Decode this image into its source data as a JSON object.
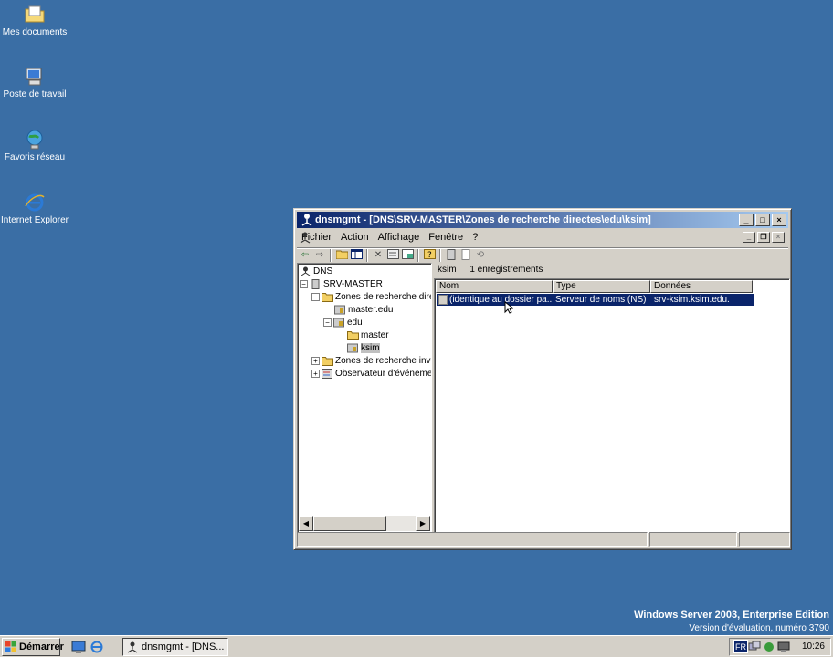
{
  "desktop": {
    "icons": [
      {
        "label": "Mes documents"
      },
      {
        "label": "Poste de travail"
      },
      {
        "label": "Favoris réseau"
      },
      {
        "label": "Internet Explorer"
      }
    ],
    "watermark_line1": "Windows Server 2003, Enterprise Edition",
    "watermark_line2": "Version d'évaluation, numéro 3790",
    "background_color": "#3a6ea5"
  },
  "window": {
    "title": "dnsmgmt - [DNS\\SRV-MASTER\\Zones de recherche directes\\edu\\ksim]",
    "menu": [
      "Fichier",
      "Action",
      "Affichage",
      "Fenêtre",
      "?"
    ],
    "tree": [
      {
        "label": "DNS",
        "icon": "dns-icon"
      },
      {
        "label": "SRV-MASTER",
        "icon": "server-icon"
      },
      {
        "label": "Zones de recherche directes",
        "icon": "folder-icon"
      },
      {
        "label": "master.edu",
        "icon": "zone-icon"
      },
      {
        "label": "edu",
        "icon": "zone-icon"
      },
      {
        "label": "master",
        "icon": "folder-icon"
      },
      {
        "label": "ksim",
        "icon": "zone-icon"
      },
      {
        "label": "Zones de recherche inversée",
        "icon": "folder-icon"
      },
      {
        "label": "Observateur d'événements",
        "icon": "event-viewer-icon"
      }
    ],
    "pane_header": {
      "name": "ksim",
      "count": "1 enregistrements"
    },
    "columns": [
      "Nom",
      "Type",
      "Données"
    ],
    "rows": [
      {
        "name": "(identique au dossier pa...",
        "type": "Serveur de noms (NS)",
        "data": "srv-ksim.ksim.edu."
      }
    ]
  },
  "taskbar": {
    "start_label": "Démarrer",
    "task_label": "dnsmgmt - [DNS...",
    "lang": "FR",
    "clock": "10:26"
  }
}
